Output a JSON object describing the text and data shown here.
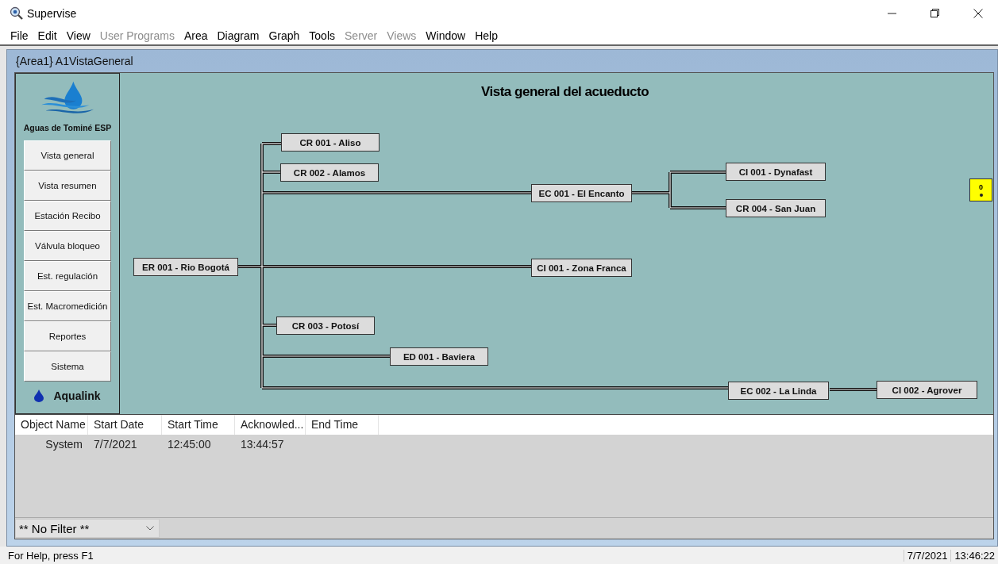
{
  "window": {
    "title": "Supervise"
  },
  "menu": [
    {
      "label": "File",
      "disabled": false
    },
    {
      "label": "Edit",
      "disabled": false
    },
    {
      "label": "View",
      "disabled": false
    },
    {
      "label": "User Programs",
      "disabled": true
    },
    {
      "label": "Area",
      "disabled": false
    },
    {
      "label": "Diagram",
      "disabled": false
    },
    {
      "label": "Graph",
      "disabled": false
    },
    {
      "label": "Tools",
      "disabled": false
    },
    {
      "label": "Server",
      "disabled": true
    },
    {
      "label": "Views",
      "disabled": true
    },
    {
      "label": "Window",
      "disabled": false
    },
    {
      "label": "Help",
      "disabled": false
    }
  ],
  "child_window": {
    "title": "{Area1} A1VistaGeneral"
  },
  "sidebar": {
    "company": "Aguas de Tominé ESP",
    "buttons": [
      "Vista general",
      "Vista resumen",
      "Estación Recibo",
      "Válvula bloqueo",
      "Est. regulación",
      "Est. Macromedición",
      "Reportes",
      "Sistema"
    ],
    "brand": "Aqualink"
  },
  "diagram": {
    "title": "Vista general del acueducto",
    "nodes": [
      {
        "label": "ER 001 - Rio Bogotá"
      },
      {
        "label": "CR 001 - Aliso"
      },
      {
        "label": "CR 002 - Alamos"
      },
      {
        "label": "EC 001 - El Encanto"
      },
      {
        "label": "CI 001 - Dynafast"
      },
      {
        "label": "CR 004 - San Juan"
      },
      {
        "label": "CI 001 - Zona Franca"
      },
      {
        "label": "CR 003 - Potosí"
      },
      {
        "label": "ED 001 - Baviera"
      },
      {
        "label": "EC 002 - La Linda"
      },
      {
        "label": "CI 002 - Agrover"
      }
    ],
    "indicator": {
      "value": "0"
    }
  },
  "alarms": {
    "columns": [
      "Object Name",
      "Start Date",
      "Start Time",
      "Acknowled...",
      "End Time"
    ],
    "rows": [
      [
        "System",
        "7/7/2021",
        "12:45:00",
        "13:44:57",
        ""
      ]
    ],
    "filter": "** No Filter **"
  },
  "status_bar": {
    "help": "For Help, press F1",
    "date": "7/7/2021",
    "time": "13:46:22"
  }
}
